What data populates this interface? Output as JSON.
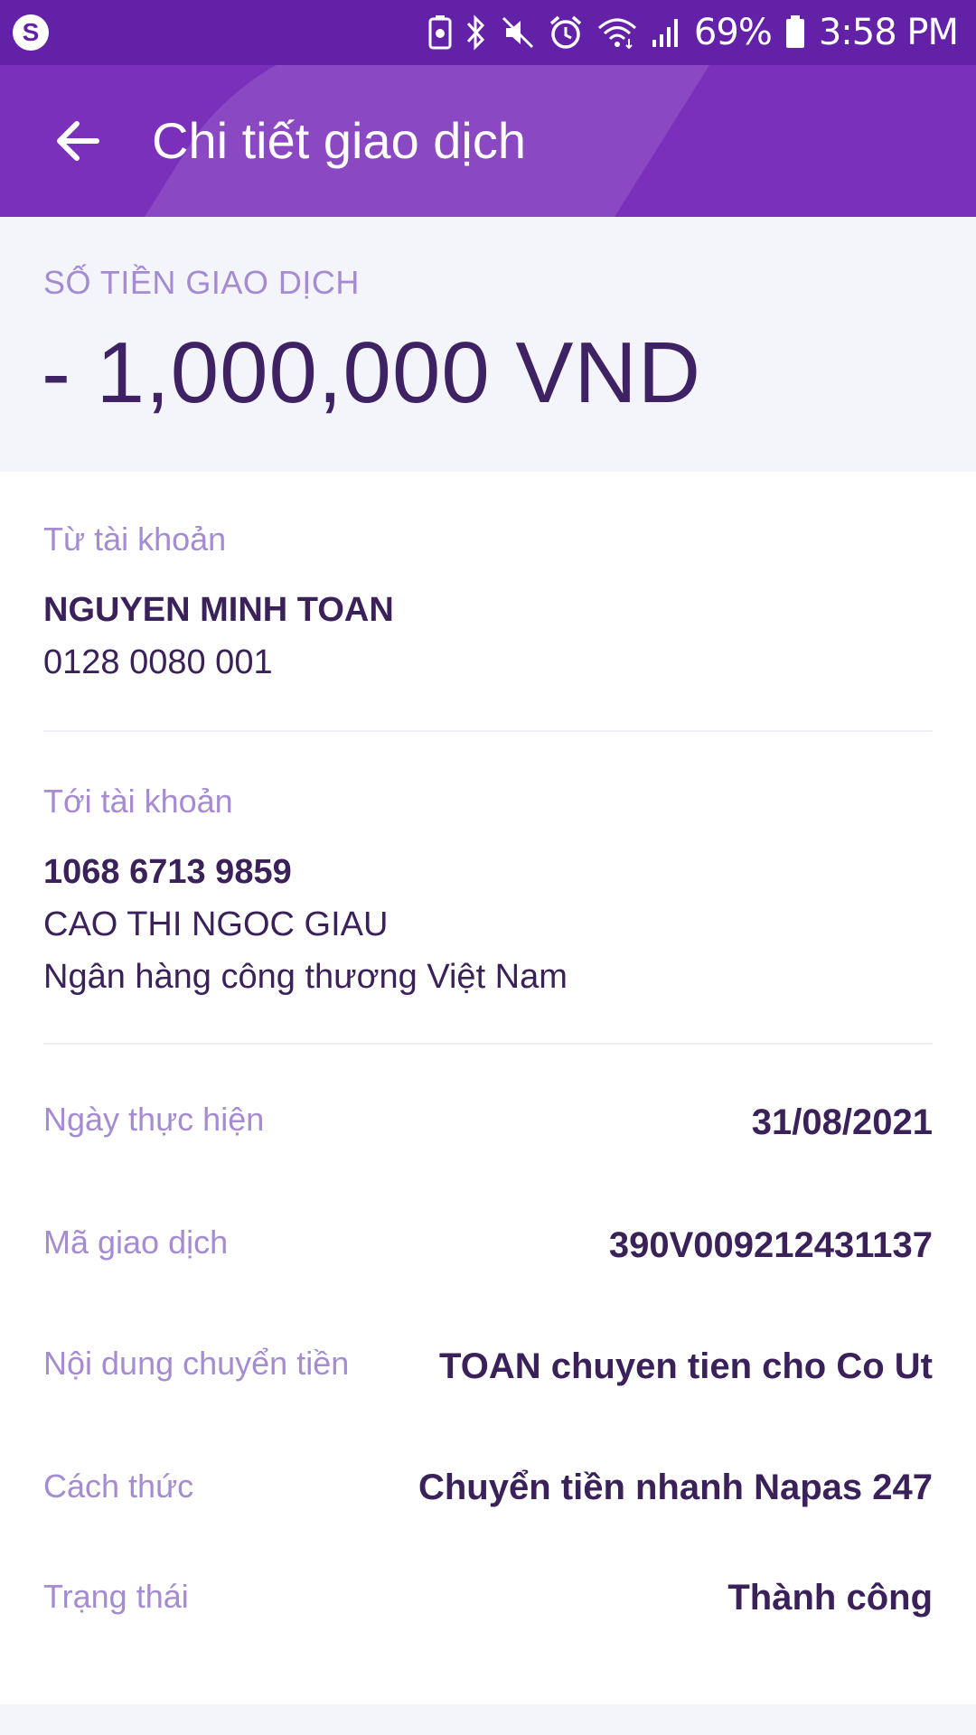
{
  "status_bar": {
    "battery_percent": "69%",
    "time": "3:58 PM"
  },
  "header": {
    "title": "Chi tiết giao dịch"
  },
  "amount": {
    "label": "SỐ TIỀN GIAO DỊCH",
    "value": "- 1,000,000 VND"
  },
  "from_account": {
    "label": "Từ tài khoản",
    "name": "NGUYEN MINH TOAN",
    "number": "0128 0080 001"
  },
  "to_account": {
    "label": "Tới tài khoản",
    "number": "1068 6713 9859",
    "name": "CAO THI NGOC GIAU",
    "bank": "Ngân hàng công thương Việt Nam"
  },
  "rows": [
    {
      "label": "Ngày thực hiện",
      "value": "31/08/2021"
    },
    {
      "label": "Mã giao dịch",
      "value": "390V009212431137"
    },
    {
      "label": "Nội dung chuyển tiền",
      "value": "TOAN chuyen tien cho Co Ut"
    },
    {
      "label": "Cách thức",
      "value": "Chuyển tiền nhanh Napas 247"
    },
    {
      "label": "Trạng thái",
      "value": "Thành công"
    }
  ],
  "colors": {
    "primary": "#7a30bb",
    "status_bar": "#6321a8",
    "label": "#a58bd1",
    "text": "#3a2159"
  }
}
